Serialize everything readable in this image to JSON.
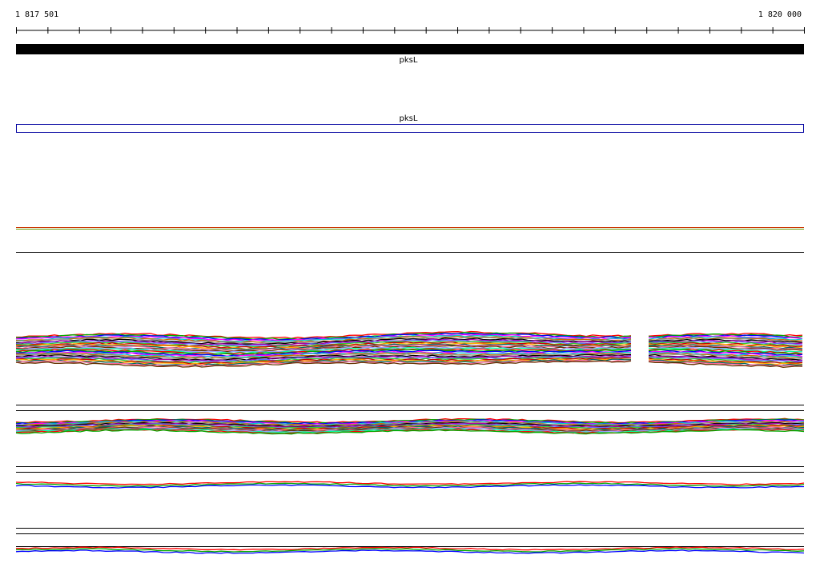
{
  "ruler": {
    "start_label": "1 817 501",
    "end_label": "1 820 000"
  },
  "tracks": {
    "gene": {
      "name": "pksL",
      "color": "#000000"
    },
    "cds": {
      "name": "pksL",
      "color": "#0000a0"
    }
  },
  "colors": {
    "palette": [
      "#ff0000",
      "#00aa00",
      "#0000ff",
      "#ff00ff",
      "#00cccc",
      "#cc6600",
      "#999999",
      "#000000",
      "#aa00aa",
      "#6666ff",
      "#33cc33",
      "#cc0000",
      "#ffaa00",
      "#006666",
      "#ff6699",
      "#663300",
      "#9999ff",
      "#00ff99"
    ]
  }
}
